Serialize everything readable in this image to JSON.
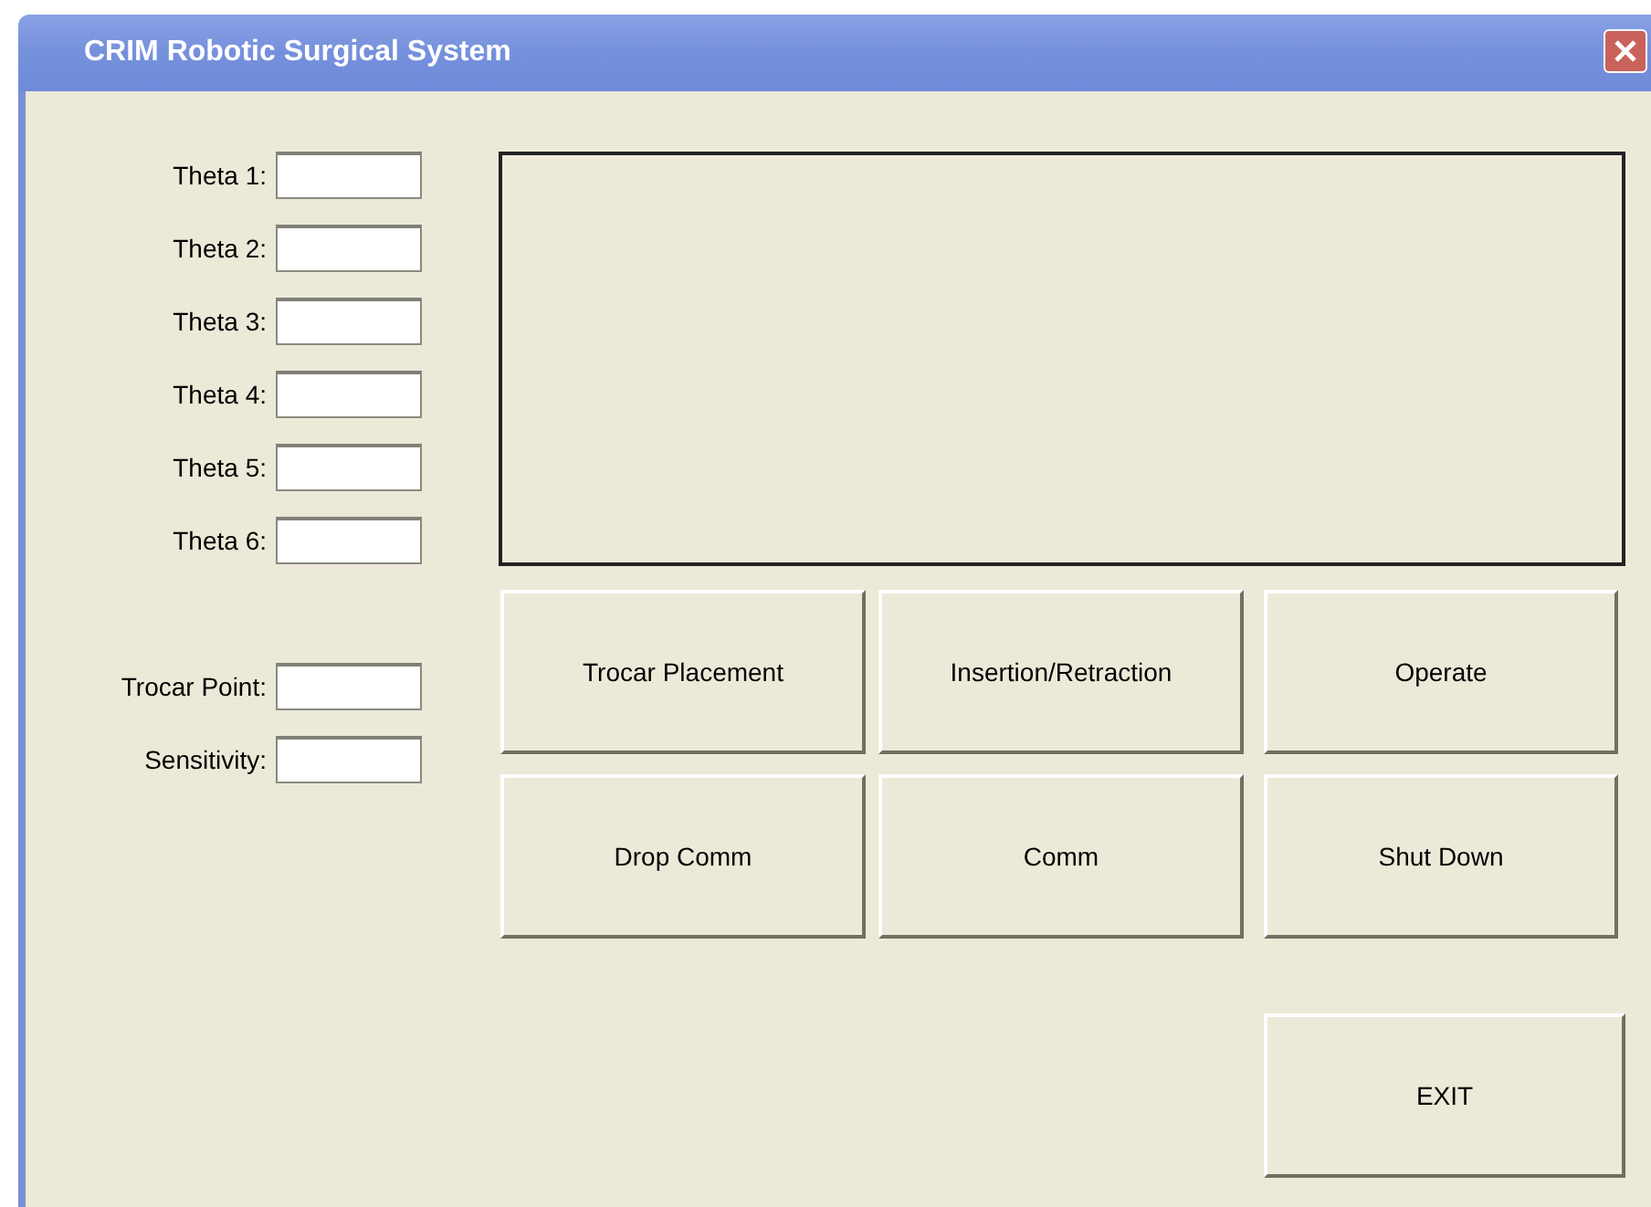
{
  "window": {
    "title": "CRIM Robotic Surgical System"
  },
  "joint_fields": [
    {
      "label": "Theta 1:"
    },
    {
      "label": "Theta 2:"
    },
    {
      "label": "Theta 3:"
    },
    {
      "label": "Theta 4:"
    },
    {
      "label": "Theta 5:"
    },
    {
      "label": "Theta 6:"
    }
  ],
  "param_fields": [
    {
      "label": "Trocar Point:"
    },
    {
      "label": "Sensitivity:"
    }
  ],
  "buttons": [
    "Trocar Placement",
    "Insertion/Retraction",
    "Operate",
    "Drop Comm",
    "Comm",
    "Shut Down"
  ],
  "exit_button": "EXIT"
}
